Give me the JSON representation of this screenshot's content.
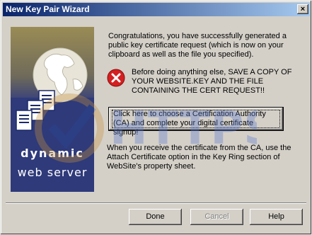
{
  "window": {
    "title": "New Key Pair Wizard",
    "close_label": "×"
  },
  "panel": {
    "brand_line1": "dynamic",
    "brand_line2": "web server"
  },
  "content": {
    "congrats": "Congratulations, you have successfully generated a public key certificate request (which is now on your clipboard as well as the file you specified).",
    "warning": "Before doing anything else, SAVE A COPY OF YOUR WEBSITE.KEY AND THE FILE CONTAINING THE CERT REQUEST!!",
    "ca_button": "Click here to choose a Certification Authority (CA) and complete your digital certificate signup!",
    "instructions": "When you receive the certificate from the CA, use the Attach Certificate option in the Key Ring section of WebSite's property sheet."
  },
  "buttons": {
    "done": "Done",
    "cancel": "Cancel",
    "help": "Help"
  },
  "watermark": {
    "text": "HTTPS"
  },
  "colors": {
    "titlebar_start": "#0a246a",
    "titlebar_end": "#a6caf0",
    "dialog_bg": "#d4d0c8",
    "panel_bg": "#2e3a7a",
    "error_red": "#d42020"
  }
}
